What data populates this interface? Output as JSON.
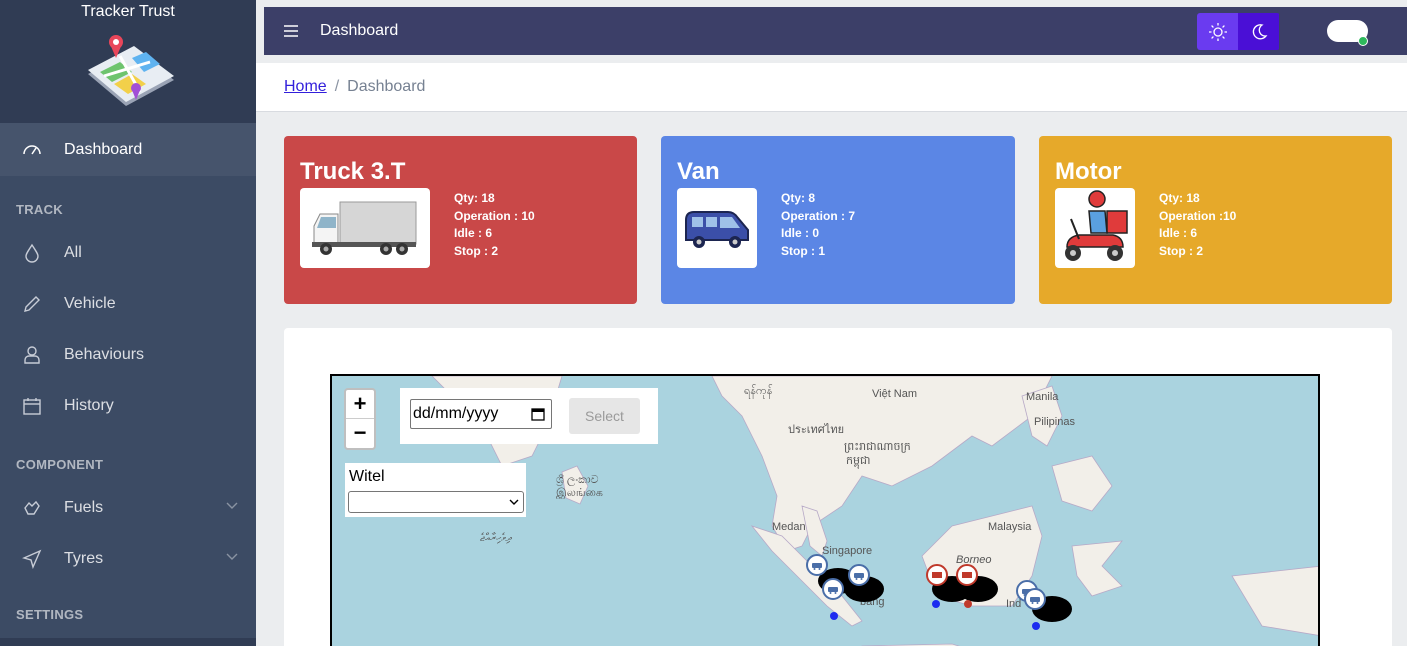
{
  "sidebar": {
    "brand": "Tracker Trust",
    "dashboard": "Dashboard",
    "section_track": "TRACK",
    "items_track": [
      "All",
      "Vehicle",
      "Behaviours",
      "History"
    ],
    "section_component": "COMPONENT",
    "items_component": [
      "Fuels",
      "Tyres"
    ],
    "section_settings": "SETTINGS"
  },
  "header": {
    "title": "Dashboard"
  },
  "breadcrumb": {
    "home": "Home",
    "separator": "/",
    "current": "Dashboard"
  },
  "cards": {
    "truck": {
      "title": "Truck 3.T",
      "qty": "Qty: 18",
      "operation": "Operation : 10",
      "idle": "Idle : 6",
      "stop": "Stop : 2"
    },
    "van": {
      "title": "Van",
      "qty": "Qty: 8",
      "operation": "Operation : 7",
      "idle": "Idle : 0",
      "stop": "Stop : 1"
    },
    "motor": {
      "title": "Motor",
      "qty": "Qty: 18",
      "operation": "Operation :10",
      "idle": "Idle : 6",
      "stop": "Stop : 2"
    }
  },
  "map": {
    "zoom_in": "+",
    "zoom_out": "−",
    "date_placeholder": "dd/mm/yyyy",
    "select_label": "Select",
    "witel_label": "Witel",
    "labels": {
      "myanmar": "ရန်ကုန်",
      "vietnam": "Việt Nam",
      "manila": "Manila",
      "pilipinas": "Pilipinas",
      "thailand": "ประเทศไทย",
      "cambodia1": "ព្រះរាជាណាចក្រ",
      "cambodia2": "កម្ពុជា",
      "srilanka1": "ශ්‍රී ලංකාව",
      "srilanka2": "இலங்கை",
      "maldives": "ދިވެހިރާއްޖެ",
      "medan": "Medan",
      "singapore": "Singapore",
      "malaysia": "Malaysia",
      "borneo": "Borneo",
      "palembang": "bang",
      "indo": "Ind"
    }
  },
  "colors": {
    "truck": "#c94848",
    "van": "#5b86e5",
    "motor": "#e6a92a",
    "sidebar": "#3c4b64",
    "header": "#3c3f68"
  }
}
